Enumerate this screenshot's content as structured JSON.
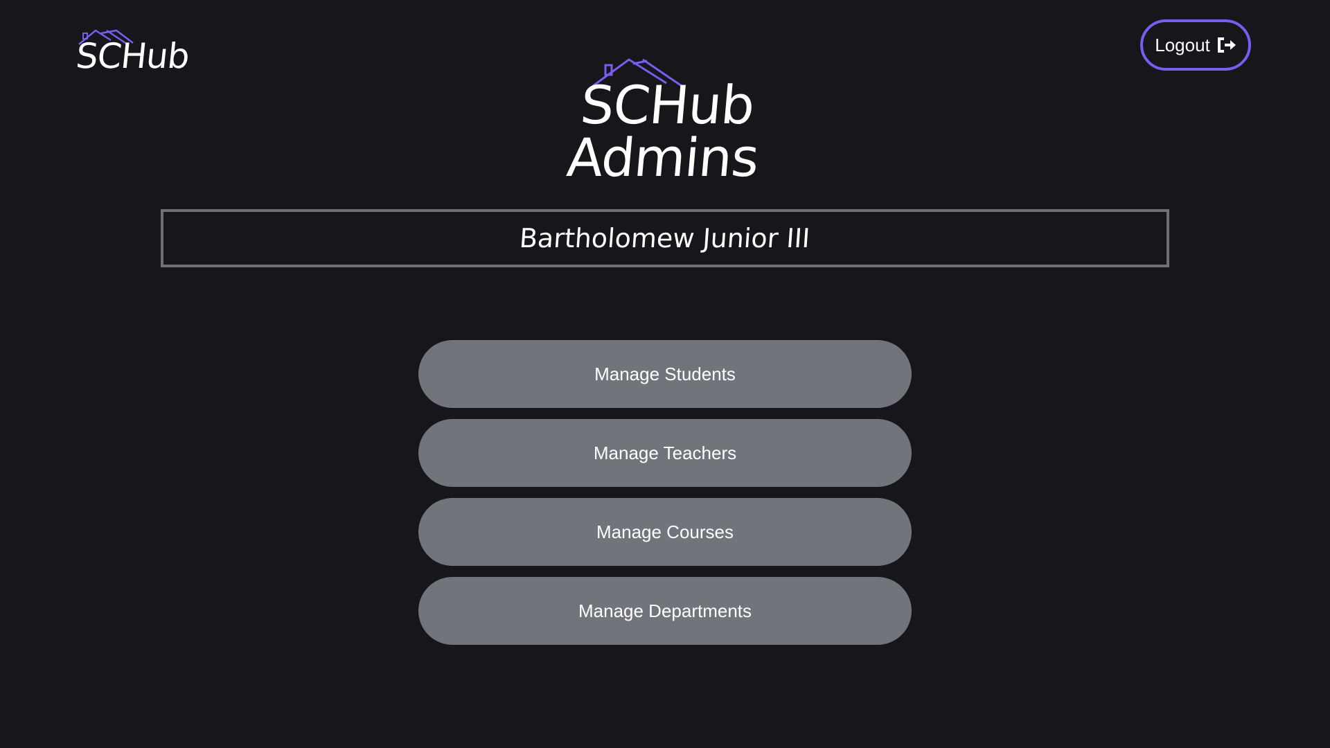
{
  "header": {
    "logo_text": "SCHub",
    "title": "SCHub Admins",
    "logout_label": "Logout"
  },
  "user": {
    "name": "Bartholomew Junior III"
  },
  "menu": {
    "items": [
      {
        "label": "Manage Students"
      },
      {
        "label": "Manage Teachers"
      },
      {
        "label": "Manage Courses"
      },
      {
        "label": "Manage Departments"
      }
    ]
  },
  "colors": {
    "background": "#16161b",
    "accent": "#7b5cf0",
    "button": "#72747c",
    "border": "#6d6e76"
  },
  "icons": {
    "logout": "logout-icon",
    "roof": "house-roof-icon"
  }
}
